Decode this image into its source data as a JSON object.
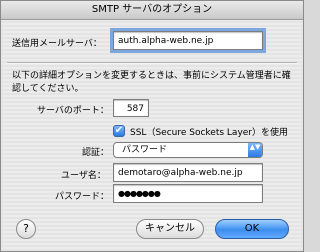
{
  "window": {
    "title": "SMTP サーバのオプション"
  },
  "server": {
    "label": "送信用メールサーバ：",
    "value": "auth.alpha-web.ne.jp"
  },
  "note": {
    "line1": "以下の詳細オプションを変更するときは、事前にシステム管理者に確",
    "line2": "認してください。"
  },
  "port": {
    "label": "サーバのポート：",
    "value": "587"
  },
  "ssl": {
    "label": "SSL（Secure Sockets Layer）を使用",
    "checked": true
  },
  "auth": {
    "label": "認証：",
    "selected": "パスワード"
  },
  "user": {
    "label": "ユーザ名：",
    "value": "demotaro@alpha-web.ne.jp"
  },
  "password": {
    "label": "パスワード：",
    "value": "●●●●●●●"
  },
  "buttons": {
    "help": "?",
    "cancel": "キャンセル",
    "ok": "OK"
  },
  "icons": {
    "checkmark": "✔",
    "popup_arrows": "▲▼"
  }
}
